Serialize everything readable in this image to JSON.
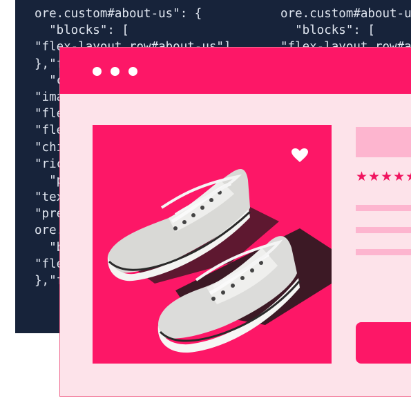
{
  "code_panel": {
    "column_1": [
      "ore.custom#about-us\": {",
      "  \"blocks\": [",
      "\"flex-layout.row#about-us\"]",
      "},\"flex-layout.row#about-us\": {",
      "  \"children\": [",
      "\"image#about-us\",",
      "\"flex-layout.col#text\"]",
      "\"flex-layout.col#text\": {",
      "\"children\": [",
      "\"rich-text#about\"]",
      "  \"props\": {",
      "\"text\": \"About us\",",
      "\"preventVerticalStretch\"",
      "ore.custom#about-us\": {",
      "  \"blocks\": [",
      "\"flex-layout.row#about-us\"]",
      "},\"flex-layout.row\""
    ],
    "column_2": [
      "ore.custom#about-us\": {",
      "  \"blocks\": [",
      "\"flex-layout.row#about-us\"]"
    ]
  },
  "window": {
    "titlebar_color": "#fd1767",
    "body_color": "#fde3ea",
    "placeholder_color": "#fdb5cf"
  },
  "product": {
    "image_icon": "sneakers-image",
    "favorite_icon": "heart-icon",
    "rating_stars": "★★★★★"
  }
}
